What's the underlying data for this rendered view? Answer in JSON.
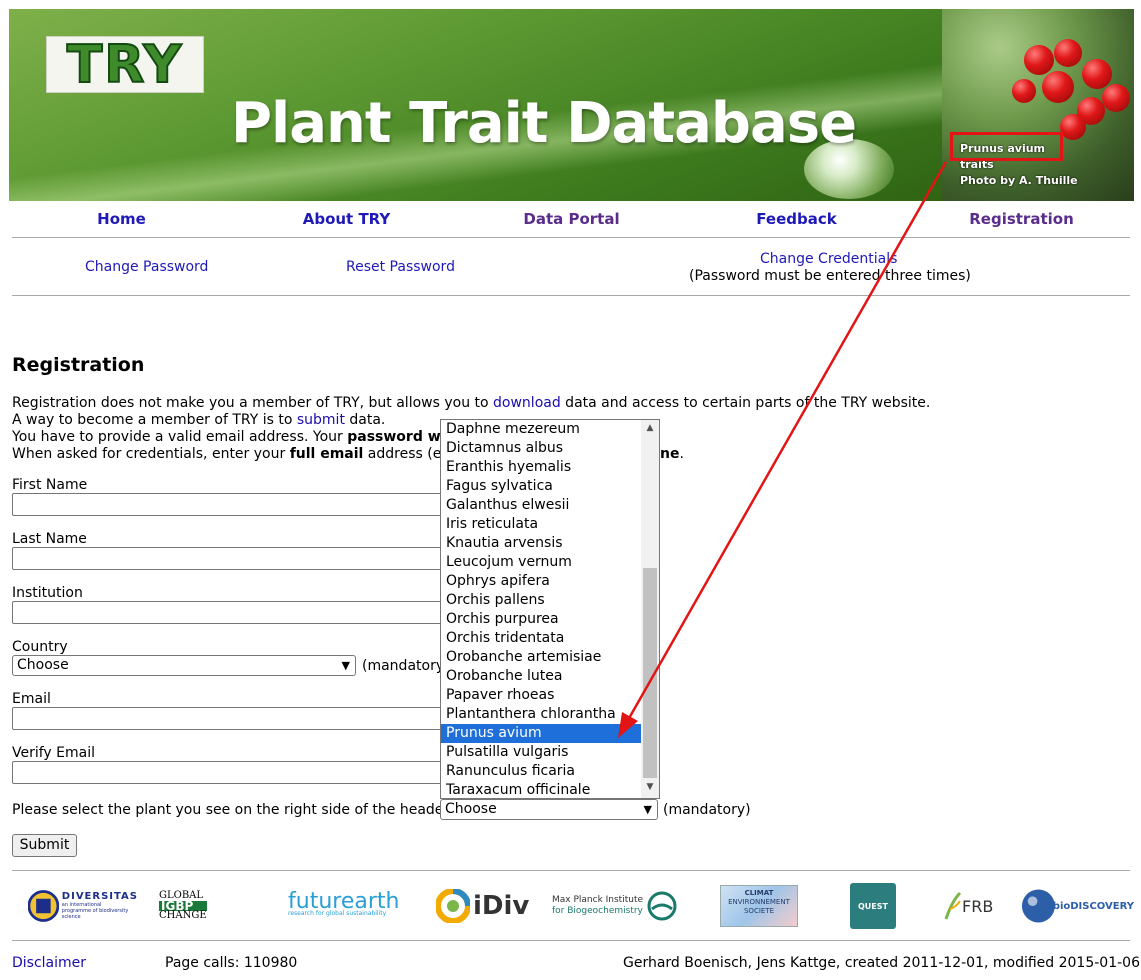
{
  "header": {
    "logo_text": "TRY",
    "title": "Plant Trait Database",
    "photo_caption_line1": "Prunus avium",
    "photo_caption_line2": "traits",
    "photo_caption_line3": "Photo by A. Thuille"
  },
  "nav": {
    "home": "Home",
    "about": "About TRY",
    "portal": "Data Portal",
    "feedback": "Feedback",
    "registration": "Registration"
  },
  "subnav": {
    "change_password": "Change Password",
    "reset_password": "Reset Password",
    "change_credentials": "Change Credentials",
    "credentials_note": "(Password must be entered three times)"
  },
  "registration": {
    "heading": "Registration",
    "line1_a": "Registration does not make you a member of TRY, but allows you to ",
    "line1_link": "download",
    "line1_b": " data and access to certain parts of the TRY website.",
    "line2_a": "A way to become a member of TRY is to ",
    "line2_link": "submit",
    "line2_b": " data.",
    "line3_a": "You have to provide a valid email address. Your ",
    "line3_bold": "password wil",
    "line4_a": "When asked for credentials, enter your ",
    "line4_bold": "full email",
    "line4_b": " address (e.g.",
    "line4_bold_end": "ne",
    "line4_end": "."
  },
  "form": {
    "first_name": "First Name",
    "last_name": "Last Name",
    "institution": "Institution",
    "country": "Country",
    "country_value": "Choose",
    "country_note": "(mandatory)",
    "email": "Email",
    "verify_email": "Verify Email",
    "plant_prompt": "Please select the plant you see on the right side of the header",
    "plant_value": "Choose",
    "plant_note": "(mandatory)",
    "submit": "Submit"
  },
  "plant_options": [
    "Daphne mezereum",
    "Dictamnus albus",
    "Eranthis hyemalis",
    "Fagus sylvatica",
    "Galanthus elwesii",
    "Iris reticulata",
    "Knautia arvensis",
    "Leucojum vernum",
    "Ophrys apifera",
    "Orchis pallens",
    "Orchis purpurea",
    "Orchis tridentata",
    "Orobanche artemisiae",
    "Orobanche lutea",
    "Papaver rhoeas",
    "Plantanthera chlorantha",
    "Prunus avium",
    "Pulsatilla vulgaris",
    "Ranunculus ficaria",
    "Taraxacum officinale"
  ],
  "selected_plant": "Prunus avium",
  "partners": {
    "diversitas": "DIVERSITAS",
    "diversitas_sub": "an international programme of biodiversity science",
    "igbp_1": "GLOBAL",
    "igbp_2": "IGBP",
    "igbp_3": "CHANGE",
    "futurearth": "futurearth",
    "futurearth_sub": "research for global sustainability",
    "idiv": "iDiv",
    "maxplanck_1": "Max Planck Institute",
    "maxplanck_2": "for Biogeochemistry",
    "climat_1": "CLIMAT",
    "climat_2": "ENVIRONNEMENT",
    "climat_3": "SOCIETE",
    "quest": "QUEST",
    "frb": "FRB",
    "biodiscovery": "bioDISCOVERY"
  },
  "footer": {
    "disclaimer": "Disclaimer",
    "page_calls": "Page calls: 110980",
    "credits": "Gerhard Boenisch, Jens Kattge, created 2011-12-01, modified 2015-01-06"
  },
  "colors": {
    "link": "#1f19b7",
    "visited": "#5a2c8c",
    "highlight": "#1e6fd9",
    "annotation": "#e31414"
  }
}
